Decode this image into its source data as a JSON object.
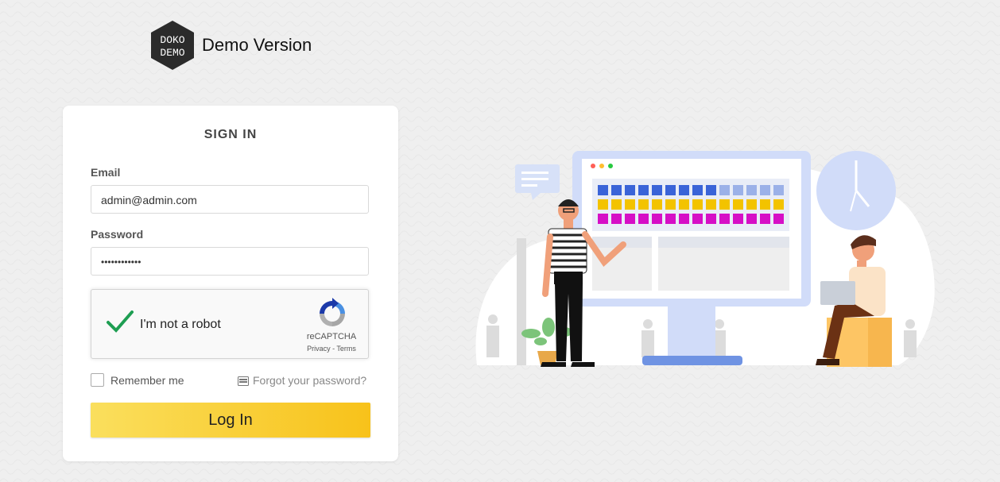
{
  "brand": {
    "logo_line1": "DOKO",
    "logo_line2": "DEMO",
    "title": "Demo Version"
  },
  "signin": {
    "heading": "SIGN IN",
    "email_label": "Email",
    "email_value": "admin@admin.com",
    "password_label": "Password",
    "password_value": "••••••••••••",
    "captcha": {
      "label": "I'm not a robot",
      "brand": "reCAPTCHA",
      "links": "Privacy - Terms",
      "checked": true
    },
    "remember_label": "Remember me",
    "forgot_label": "Forgot your password?",
    "login_label": "Log In"
  },
  "colors": {
    "button_start": "#fadf5d",
    "button_end": "#f8c21a",
    "check_green": "#1e9e52"
  },
  "icons": [
    "doko-demo-logo",
    "checkmark-icon",
    "recaptcha-icon",
    "keyboard-icon"
  ]
}
